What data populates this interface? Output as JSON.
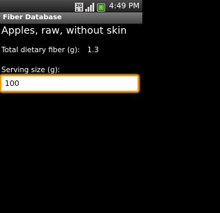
{
  "status_bar": {
    "network_label": "3G",
    "time": "4:49",
    "time_suffix": "PM",
    "icons": [
      "network-3g-icon",
      "signal-strength-icon",
      "battery-icon"
    ]
  },
  "app": {
    "title": "Fiber Database"
  },
  "food": {
    "name": "Apples, raw, without skin",
    "fiber_label": "Total dietary fiber (g):",
    "fiber_value": "1.3"
  },
  "serving": {
    "label": "Serving size (g):",
    "value": "100"
  },
  "colors": {
    "background": "#000000",
    "text": "#ffffff",
    "input_focus": "#ff9900",
    "battery_green": "#4fc21a"
  }
}
